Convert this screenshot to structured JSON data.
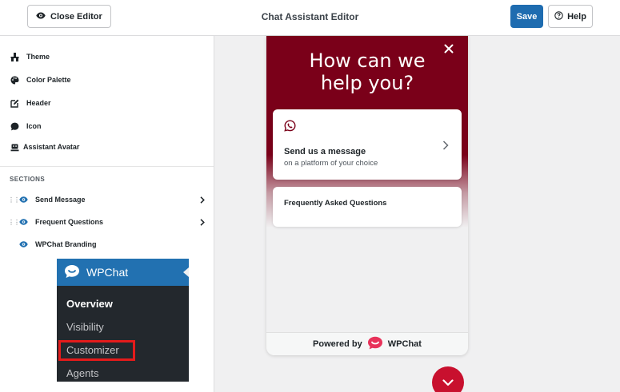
{
  "topbar": {
    "close_label": "Close Editor",
    "title": "Chat Assistant Editor",
    "save_label": "Save",
    "help_label": "Help"
  },
  "sidebar": {
    "items": [
      {
        "label": "Theme",
        "icon": "brush-icon"
      },
      {
        "label": "Color Palette",
        "icon": "palette-icon"
      },
      {
        "label": "Header",
        "icon": "edit-icon"
      },
      {
        "label": "Icon",
        "icon": "chat-bubble-icon"
      },
      {
        "label": "Assistant Avatar",
        "icon": "robot-icon"
      }
    ],
    "sections_label": "SECTIONS",
    "sections": [
      {
        "label": "Send Message"
      },
      {
        "label": "Frequent Questions"
      },
      {
        "label": "WPChat Branding"
      }
    ]
  },
  "wp_menu": {
    "brand": "WPChat",
    "items": [
      {
        "label": "Overview"
      },
      {
        "label": "Visibility"
      },
      {
        "label": "Customizer"
      },
      {
        "label": "Agents"
      }
    ]
  },
  "widget": {
    "title_line1": "How can we",
    "title_line2": "help you?",
    "message_card_title": "Send us a message",
    "message_card_subtitle": "on a platform of your choice",
    "faq_card_title": "Frequently Asked Questions",
    "powered_by": "Powered by",
    "brand": "WPChat"
  },
  "colors": {
    "accent": "#1e6cb0",
    "hero": "#7a0019",
    "fab": "#c8102e",
    "wp_menu_bg": "#23282d",
    "wp_menu_head": "#2271b1",
    "highlight": "#e41b1b"
  }
}
